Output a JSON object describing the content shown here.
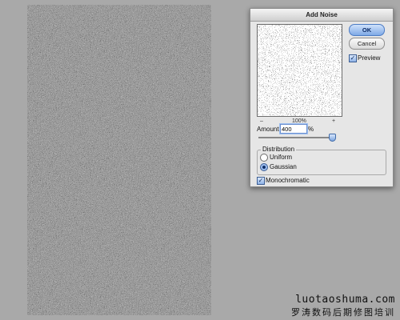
{
  "canvas": {
    "description_icon": "noise-texture"
  },
  "dialog": {
    "title": "Add Noise",
    "zoom": {
      "minus": "–",
      "level": "100%",
      "plus": "+"
    },
    "buttons": {
      "ok": "OK",
      "cancel": "Cancel"
    },
    "preview": {
      "label": "Preview",
      "checked": true
    },
    "amount": {
      "label": "Amount:",
      "value": "400",
      "unit": "%",
      "level": 1.0
    },
    "distribution": {
      "title": "Distribution",
      "options": [
        {
          "label": "Uniform",
          "selected": false
        },
        {
          "label": "Gaussian",
          "selected": true
        }
      ]
    },
    "monochromatic": {
      "label": "Monochromatic",
      "checked": true
    }
  },
  "watermark": {
    "line1": "luotaoshuma.com",
    "line2": "罗涛数码后期修图培训"
  }
}
